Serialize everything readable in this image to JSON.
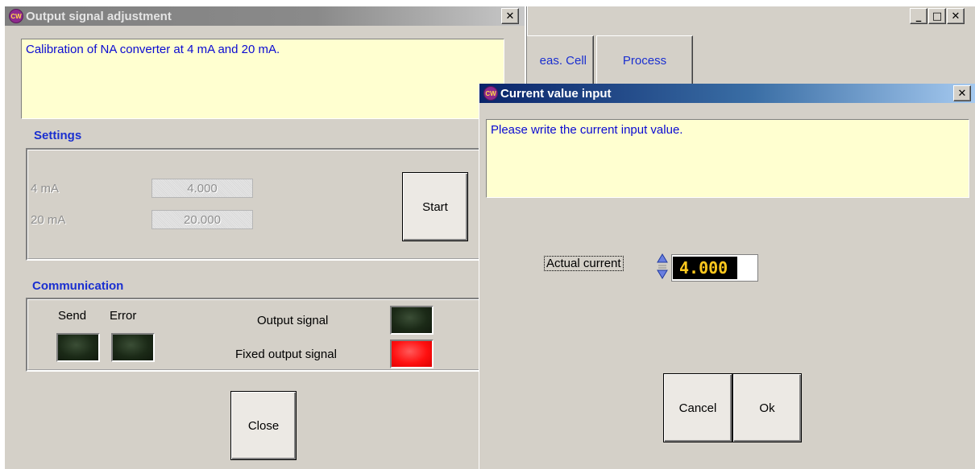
{
  "background_window": {
    "tabs": [
      {
        "label": "eas. Cell"
      },
      {
        "label": "Process"
      }
    ],
    "caption_buttons": {
      "minimize": "_",
      "maximize": "□",
      "close": "✕"
    }
  },
  "output_dialog": {
    "title": "Output signal adjustment",
    "close_glyph": "✕",
    "description": "Calibration of NA converter at 4 mA and 20 mA.",
    "settings": {
      "heading": "Settings",
      "rows": [
        {
          "label": "4 mA",
          "value": "4.000"
        },
        {
          "label": "20 mA",
          "value": "20.000"
        }
      ],
      "start_label": "Start"
    },
    "communication": {
      "heading": "Communication",
      "send_label": "Send",
      "error_label": "Error",
      "output_signal_label": "Output signal",
      "fixed_output_label": "Fixed output signal"
    },
    "close_label": "Close"
  },
  "current_dialog": {
    "title": "Current value input",
    "close_glyph": "✕",
    "description": "Please write the current input value.",
    "actual_current_label": "Actual current",
    "actual_current_value": "4.000",
    "cancel_label": "Cancel",
    "ok_label": "Ok"
  },
  "colors": {
    "accent_blue": "#1a2fd0",
    "info_background": "#ffffd0",
    "led_off": "#1b2a17",
    "led_on_red": "#ff1010",
    "display_digits": "#ffc81e"
  },
  "icons": {
    "app": "app-logo-icon",
    "spinner": "spin-up-down-icon"
  }
}
